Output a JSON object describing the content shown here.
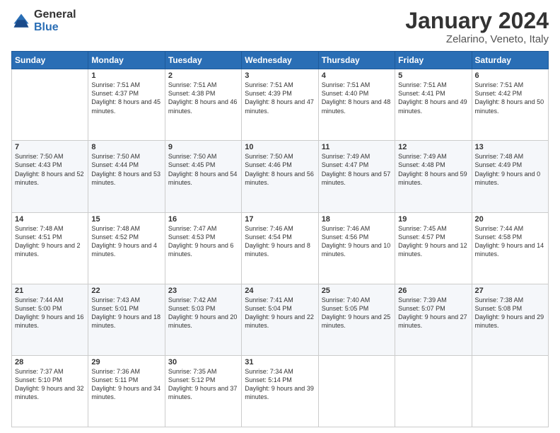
{
  "logo": {
    "general": "General",
    "blue": "Blue"
  },
  "title": "January 2024",
  "subtitle": "Zelarino, Veneto, Italy",
  "header_days": [
    "Sunday",
    "Monday",
    "Tuesday",
    "Wednesday",
    "Thursday",
    "Friday",
    "Saturday"
  ],
  "weeks": [
    [
      {
        "day": "",
        "sunrise": "",
        "sunset": "",
        "daylight": ""
      },
      {
        "day": "1",
        "sunrise": "Sunrise: 7:51 AM",
        "sunset": "Sunset: 4:37 PM",
        "daylight": "Daylight: 8 hours and 45 minutes."
      },
      {
        "day": "2",
        "sunrise": "Sunrise: 7:51 AM",
        "sunset": "Sunset: 4:38 PM",
        "daylight": "Daylight: 8 hours and 46 minutes."
      },
      {
        "day": "3",
        "sunrise": "Sunrise: 7:51 AM",
        "sunset": "Sunset: 4:39 PM",
        "daylight": "Daylight: 8 hours and 47 minutes."
      },
      {
        "day": "4",
        "sunrise": "Sunrise: 7:51 AM",
        "sunset": "Sunset: 4:40 PM",
        "daylight": "Daylight: 8 hours and 48 minutes."
      },
      {
        "day": "5",
        "sunrise": "Sunrise: 7:51 AM",
        "sunset": "Sunset: 4:41 PM",
        "daylight": "Daylight: 8 hours and 49 minutes."
      },
      {
        "day": "6",
        "sunrise": "Sunrise: 7:51 AM",
        "sunset": "Sunset: 4:42 PM",
        "daylight": "Daylight: 8 hours and 50 minutes."
      }
    ],
    [
      {
        "day": "7",
        "sunrise": "Sunrise: 7:50 AM",
        "sunset": "Sunset: 4:43 PM",
        "daylight": "Daylight: 8 hours and 52 minutes."
      },
      {
        "day": "8",
        "sunrise": "Sunrise: 7:50 AM",
        "sunset": "Sunset: 4:44 PM",
        "daylight": "Daylight: 8 hours and 53 minutes."
      },
      {
        "day": "9",
        "sunrise": "Sunrise: 7:50 AM",
        "sunset": "Sunset: 4:45 PM",
        "daylight": "Daylight: 8 hours and 54 minutes."
      },
      {
        "day": "10",
        "sunrise": "Sunrise: 7:50 AM",
        "sunset": "Sunset: 4:46 PM",
        "daylight": "Daylight: 8 hours and 56 minutes."
      },
      {
        "day": "11",
        "sunrise": "Sunrise: 7:49 AM",
        "sunset": "Sunset: 4:47 PM",
        "daylight": "Daylight: 8 hours and 57 minutes."
      },
      {
        "day": "12",
        "sunrise": "Sunrise: 7:49 AM",
        "sunset": "Sunset: 4:48 PM",
        "daylight": "Daylight: 8 hours and 59 minutes."
      },
      {
        "day": "13",
        "sunrise": "Sunrise: 7:48 AM",
        "sunset": "Sunset: 4:49 PM",
        "daylight": "Daylight: 9 hours and 0 minutes."
      }
    ],
    [
      {
        "day": "14",
        "sunrise": "Sunrise: 7:48 AM",
        "sunset": "Sunset: 4:51 PM",
        "daylight": "Daylight: 9 hours and 2 minutes."
      },
      {
        "day": "15",
        "sunrise": "Sunrise: 7:48 AM",
        "sunset": "Sunset: 4:52 PM",
        "daylight": "Daylight: 9 hours and 4 minutes."
      },
      {
        "day": "16",
        "sunrise": "Sunrise: 7:47 AM",
        "sunset": "Sunset: 4:53 PM",
        "daylight": "Daylight: 9 hours and 6 minutes."
      },
      {
        "day": "17",
        "sunrise": "Sunrise: 7:46 AM",
        "sunset": "Sunset: 4:54 PM",
        "daylight": "Daylight: 9 hours and 8 minutes."
      },
      {
        "day": "18",
        "sunrise": "Sunrise: 7:46 AM",
        "sunset": "Sunset: 4:56 PM",
        "daylight": "Daylight: 9 hours and 10 minutes."
      },
      {
        "day": "19",
        "sunrise": "Sunrise: 7:45 AM",
        "sunset": "Sunset: 4:57 PM",
        "daylight": "Daylight: 9 hours and 12 minutes."
      },
      {
        "day": "20",
        "sunrise": "Sunrise: 7:44 AM",
        "sunset": "Sunset: 4:58 PM",
        "daylight": "Daylight: 9 hours and 14 minutes."
      }
    ],
    [
      {
        "day": "21",
        "sunrise": "Sunrise: 7:44 AM",
        "sunset": "Sunset: 5:00 PM",
        "daylight": "Daylight: 9 hours and 16 minutes."
      },
      {
        "day": "22",
        "sunrise": "Sunrise: 7:43 AM",
        "sunset": "Sunset: 5:01 PM",
        "daylight": "Daylight: 9 hours and 18 minutes."
      },
      {
        "day": "23",
        "sunrise": "Sunrise: 7:42 AM",
        "sunset": "Sunset: 5:03 PM",
        "daylight": "Daylight: 9 hours and 20 minutes."
      },
      {
        "day": "24",
        "sunrise": "Sunrise: 7:41 AM",
        "sunset": "Sunset: 5:04 PM",
        "daylight": "Daylight: 9 hours and 22 minutes."
      },
      {
        "day": "25",
        "sunrise": "Sunrise: 7:40 AM",
        "sunset": "Sunset: 5:05 PM",
        "daylight": "Daylight: 9 hours and 25 minutes."
      },
      {
        "day": "26",
        "sunrise": "Sunrise: 7:39 AM",
        "sunset": "Sunset: 5:07 PM",
        "daylight": "Daylight: 9 hours and 27 minutes."
      },
      {
        "day": "27",
        "sunrise": "Sunrise: 7:38 AM",
        "sunset": "Sunset: 5:08 PM",
        "daylight": "Daylight: 9 hours and 29 minutes."
      }
    ],
    [
      {
        "day": "28",
        "sunrise": "Sunrise: 7:37 AM",
        "sunset": "Sunset: 5:10 PM",
        "daylight": "Daylight: 9 hours and 32 minutes."
      },
      {
        "day": "29",
        "sunrise": "Sunrise: 7:36 AM",
        "sunset": "Sunset: 5:11 PM",
        "daylight": "Daylight: 9 hours and 34 minutes."
      },
      {
        "day": "30",
        "sunrise": "Sunrise: 7:35 AM",
        "sunset": "Sunset: 5:12 PM",
        "daylight": "Daylight: 9 hours and 37 minutes."
      },
      {
        "day": "31",
        "sunrise": "Sunrise: 7:34 AM",
        "sunset": "Sunset: 5:14 PM",
        "daylight": "Daylight: 9 hours and 39 minutes."
      },
      {
        "day": "",
        "sunrise": "",
        "sunset": "",
        "daylight": ""
      },
      {
        "day": "",
        "sunrise": "",
        "sunset": "",
        "daylight": ""
      },
      {
        "day": "",
        "sunrise": "",
        "sunset": "",
        "daylight": ""
      }
    ]
  ]
}
